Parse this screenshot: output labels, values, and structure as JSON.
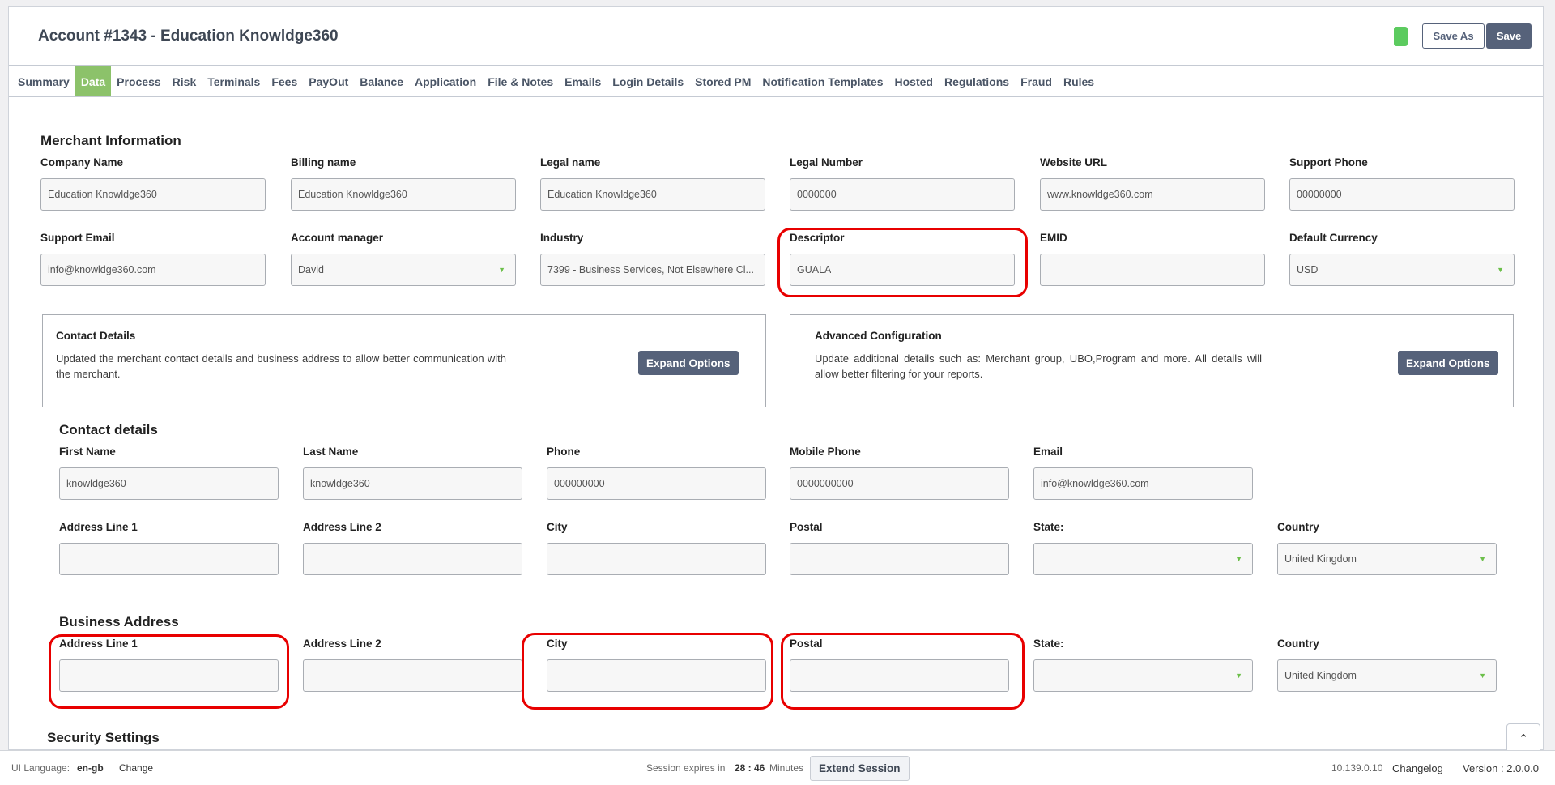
{
  "header": {
    "title": "Account #1343 - Education Knowldge360",
    "save_as_label": "Save As",
    "save_label": "Save",
    "status_color": "#5ccb5f"
  },
  "tabs": [
    "Summary",
    "Data",
    "Process",
    "Risk",
    "Terminals",
    "Fees",
    "PayOut",
    "Balance",
    "Application",
    "File & Notes",
    "Emails",
    "Login Details",
    "Stored PM",
    "Notification Templates",
    "Hosted",
    "Regulations",
    "Fraud",
    "Rules"
  ],
  "active_tab": "Data",
  "merchant": {
    "title": "Merchant Information",
    "company_name": {
      "label": "Company Name",
      "value": "Education Knowldge360"
    },
    "billing_name": {
      "label": "Billing name",
      "value": "Education Knowldge360"
    },
    "legal_name": {
      "label": "Legal name",
      "value": "Education Knowldge360"
    },
    "legal_number": {
      "label": "Legal Number",
      "value": "0000000"
    },
    "website_url": {
      "label": "Website URL",
      "value": "www.knowldge360.com"
    },
    "support_phone": {
      "label": "Support Phone",
      "value": "00000000"
    },
    "support_email": {
      "label": "Support Email",
      "value": "info@knowldge360.com"
    },
    "account_manager": {
      "label": "Account manager",
      "value": "David"
    },
    "industry": {
      "label": "Industry",
      "value": "7399 - Business Services, Not Elsewhere Cl..."
    },
    "descriptor": {
      "label": "Descriptor",
      "value": "GUALA"
    },
    "emid": {
      "label": "EMID",
      "value": ""
    },
    "default_currency": {
      "label": "Default Currency",
      "value": "USD"
    }
  },
  "contact_box": {
    "title": "Contact Details",
    "text": "Updated the merchant contact details and business address to allow better communication with the merchant.",
    "button": "Expand Options"
  },
  "advanced_box": {
    "title": "Advanced Configuration",
    "text": "Update additional details such as: Merchant group, UBO,Program and more. All details will allow better filtering for your reports.",
    "button": "Expand Options"
  },
  "contact": {
    "title": "Contact details",
    "first_name": {
      "label": "First Name",
      "value": "knowldge360"
    },
    "last_name": {
      "label": "Last Name",
      "value": "knowldge360"
    },
    "phone": {
      "label": "Phone",
      "value": "000000000"
    },
    "mobile_phone": {
      "label": "Mobile Phone",
      "value": "0000000000"
    },
    "email": {
      "label": "Email",
      "value": "info@knowldge360.com"
    },
    "address1": {
      "label": "Address Line 1",
      "value": ""
    },
    "address2": {
      "label": "Address Line 2",
      "value": ""
    },
    "city": {
      "label": "City",
      "value": ""
    },
    "postal": {
      "label": "Postal",
      "value": ""
    },
    "state": {
      "label": "State:",
      "value": ""
    },
    "country": {
      "label": "Country",
      "value": "United Kingdom"
    }
  },
  "business": {
    "title": "Business Address",
    "address1": {
      "label": "Address Line 1",
      "value": ""
    },
    "address2": {
      "label": "Address Line 2",
      "value": ""
    },
    "city": {
      "label": "City",
      "value": ""
    },
    "postal": {
      "label": "Postal",
      "value": ""
    },
    "state": {
      "label": "State:",
      "value": ""
    },
    "country": {
      "label": "Country",
      "value": "United Kingdom"
    }
  },
  "security": {
    "title": "Security Settings"
  },
  "footer": {
    "ui_language_label": "UI Language:",
    "ui_language_value": "en-gb",
    "change_label": "Change",
    "session_prefix": "Session expires in",
    "session_time": "28 : 46",
    "session_suffix": "Minutes",
    "extend_label": "Extend Session",
    "ip": "10.139.0.10",
    "changelog": "Changelog",
    "version": "Version : 2.0.0.0"
  },
  "highlight_color": "#e80000"
}
